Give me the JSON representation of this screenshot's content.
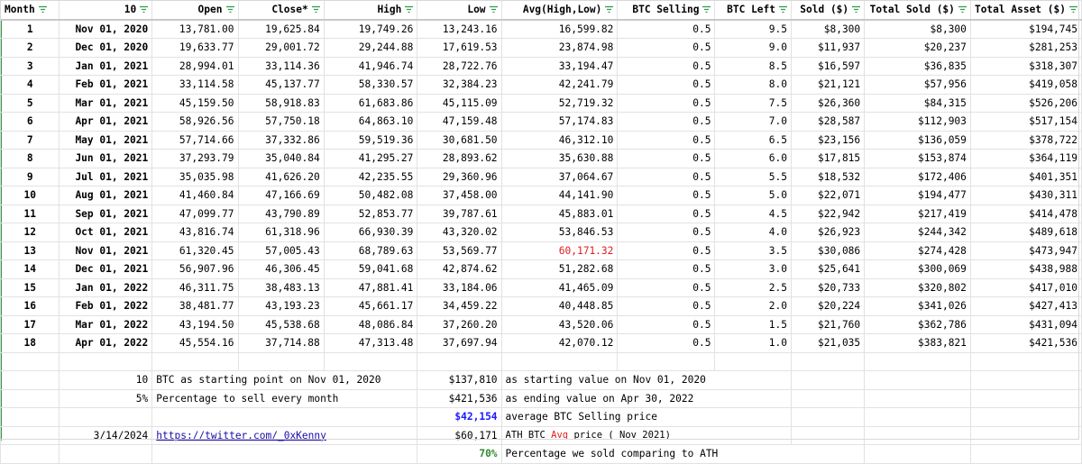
{
  "headers": [
    "Month",
    "10",
    "Open",
    "Close*",
    "High",
    "Low",
    "Avg(High,Low)",
    "BTC Selling",
    "BTC Left",
    "Sold ($)",
    "Total Sold ($)",
    "Total Asset ($)"
  ],
  "rows": [
    [
      "1",
      "Nov 01, 2020",
      "13,781.00",
      "19,625.84",
      "19,749.26",
      "13,243.16",
      "16,599.82",
      "0.5",
      "9.5",
      "$8,300",
      "$8,300",
      "$194,745"
    ],
    [
      "2",
      "Dec 01, 2020",
      "19,633.77",
      "29,001.72",
      "29,244.88",
      "17,619.53",
      "23,874.98",
      "0.5",
      "9.0",
      "$11,937",
      "$20,237",
      "$281,253"
    ],
    [
      "3",
      "Jan 01, 2021",
      "28,994.01",
      "33,114.36",
      "41,946.74",
      "28,722.76",
      "33,194.47",
      "0.5",
      "8.5",
      "$16,597",
      "$36,835",
      "$318,307"
    ],
    [
      "4",
      "Feb 01, 2021",
      "33,114.58",
      "45,137.77",
      "58,330.57",
      "32,384.23",
      "42,241.79",
      "0.5",
      "8.0",
      "$21,121",
      "$57,956",
      "$419,058"
    ],
    [
      "5",
      "Mar 01, 2021",
      "45,159.50",
      "58,918.83",
      "61,683.86",
      "45,115.09",
      "52,719.32",
      "0.5",
      "7.5",
      "$26,360",
      "$84,315",
      "$526,206"
    ],
    [
      "6",
      "Apr 01, 2021",
      "58,926.56",
      "57,750.18",
      "64,863.10",
      "47,159.48",
      "57,174.83",
      "0.5",
      "7.0",
      "$28,587",
      "$112,903",
      "$517,154"
    ],
    [
      "7",
      "May 01, 2021",
      "57,714.66",
      "37,332.86",
      "59,519.36",
      "30,681.50",
      "46,312.10",
      "0.5",
      "6.5",
      "$23,156",
      "$136,059",
      "$378,722"
    ],
    [
      "8",
      "Jun 01, 2021",
      "37,293.79",
      "35,040.84",
      "41,295.27",
      "28,893.62",
      "35,630.88",
      "0.5",
      "6.0",
      "$17,815",
      "$153,874",
      "$364,119"
    ],
    [
      "9",
      "Jul 01, 2021",
      "35,035.98",
      "41,626.20",
      "42,235.55",
      "29,360.96",
      "37,064.67",
      "0.5",
      "5.5",
      "$18,532",
      "$172,406",
      "$401,351"
    ],
    [
      "10",
      "Aug 01, 2021",
      "41,460.84",
      "47,166.69",
      "50,482.08",
      "37,458.00",
      "44,141.90",
      "0.5",
      "5.0",
      "$22,071",
      "$194,477",
      "$430,311"
    ],
    [
      "11",
      "Sep 01, 2021",
      "47,099.77",
      "43,790.89",
      "52,853.77",
      "39,787.61",
      "45,883.01",
      "0.5",
      "4.5",
      "$22,942",
      "$217,419",
      "$414,478"
    ],
    [
      "12",
      "Oct 01, 2021",
      "43,816.74",
      "61,318.96",
      "66,930.39",
      "43,320.02",
      "53,846.53",
      "0.5",
      "4.0",
      "$26,923",
      "$244,342",
      "$489,618"
    ],
    [
      "13",
      "Nov 01, 2021",
      "61,320.45",
      "57,005.43",
      "68,789.63",
      "53,569.77",
      "60,171.32",
      "0.5",
      "3.5",
      "$30,086",
      "$274,428",
      "$473,947"
    ],
    [
      "14",
      "Dec 01, 2021",
      "56,907.96",
      "46,306.45",
      "59,041.68",
      "42,874.62",
      "51,282.68",
      "0.5",
      "3.0",
      "$25,641",
      "$300,069",
      "$438,988"
    ],
    [
      "15",
      "Jan 01, 2022",
      "46,311.75",
      "38,483.13",
      "47,881.41",
      "33,184.06",
      "41,465.09",
      "0.5",
      "2.5",
      "$20,733",
      "$320,802",
      "$417,010"
    ],
    [
      "16",
      "Feb 01, 2022",
      "38,481.77",
      "43,193.23",
      "45,661.17",
      "34,459.22",
      "40,448.85",
      "0.5",
      "2.0",
      "$20,224",
      "$341,026",
      "$427,413"
    ],
    [
      "17",
      "Mar 01, 2022",
      "43,194.50",
      "45,538.68",
      "48,086.84",
      "37,260.20",
      "43,520.06",
      "0.5",
      "1.5",
      "$21,760",
      "$362,786",
      "$431,094"
    ],
    [
      "18",
      "Apr 01, 2022",
      "45,554.16",
      "37,714.88",
      "47,313.48",
      "37,697.94",
      "42,070.12",
      "0.5",
      "1.0",
      "$21,035",
      "$383,821",
      "$421,536"
    ]
  ],
  "highlight_row": 12,
  "highlight_col": 6,
  "summary": {
    "btc_start_value": "10",
    "btc_start_text": "BTC as starting point on Nov 01, 2020",
    "pct_value": "5%",
    "pct_text": "Percentage to sell every month",
    "date": "3/14/2024",
    "link": "https://twitter.com/_0xKenny",
    "start_value": "$137,810",
    "start_value_text": "as starting value on Nov 01, 2020",
    "end_value": "$421,536",
    "end_value_text": "as ending value on Apr 30, 2022",
    "avg_value": "$42,154",
    "avg_text": "average BTC Selling price",
    "ath_value": "$60,171",
    "ath_text_pre": "ATH BTC",
    "ath_text_avg": "Avg",
    "ath_text_post": "price ( Nov 2021)",
    "pct_sold_value": "70%",
    "pct_sold_text": "Percentage we sold comparing to ATH"
  },
  "colors": {
    "highlight": "#e21c1c",
    "avg_blue": "#1a1aff",
    "pct_green": "#2e8b2e",
    "link": "#1a0dab"
  }
}
